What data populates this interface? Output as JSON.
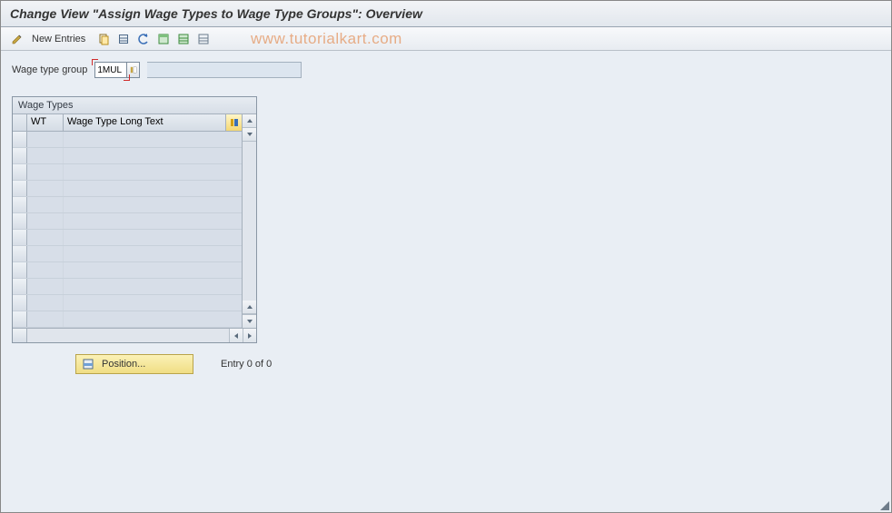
{
  "header": {
    "title": "Change View \"Assign Wage Types to Wage Type Groups\": Overview"
  },
  "toolbar": {
    "new_entries_label": "New Entries"
  },
  "watermark": "www.tutorialkart.com",
  "filter": {
    "label": "Wage type group",
    "value": "1MUL"
  },
  "table": {
    "panel_title": "Wage Types",
    "col_wt": "WT",
    "col_long": "Wage Type Long Text",
    "row_count": 12
  },
  "footer": {
    "position_label": "Position...",
    "entry_text": "Entry 0 of 0"
  }
}
